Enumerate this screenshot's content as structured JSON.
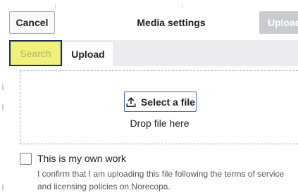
{
  "header": {
    "cancel_label": "Cancel",
    "title": "Media settings",
    "upload_label": "Upload"
  },
  "tabs": [
    {
      "label": "Search",
      "selected": false,
      "highlighted": true
    },
    {
      "label": "Upload",
      "selected": true
    }
  ],
  "dropzone": {
    "select_label": "Select a file",
    "drop_text": "Drop file here",
    "select_icon": "upload-icon"
  },
  "own_work": {
    "checkbox_label": "This is my own work",
    "checked": false,
    "confirm_text": "I confirm that I am uploading this file following the terms of service and licensing policies on Norecopa."
  },
  "colors": {
    "progressive": "#3366cc",
    "disabled_button": "#c8ccd1",
    "tab_bar": "#eaecf0",
    "highlight": "#eef27a",
    "highlight_border": "#1e2f52"
  }
}
